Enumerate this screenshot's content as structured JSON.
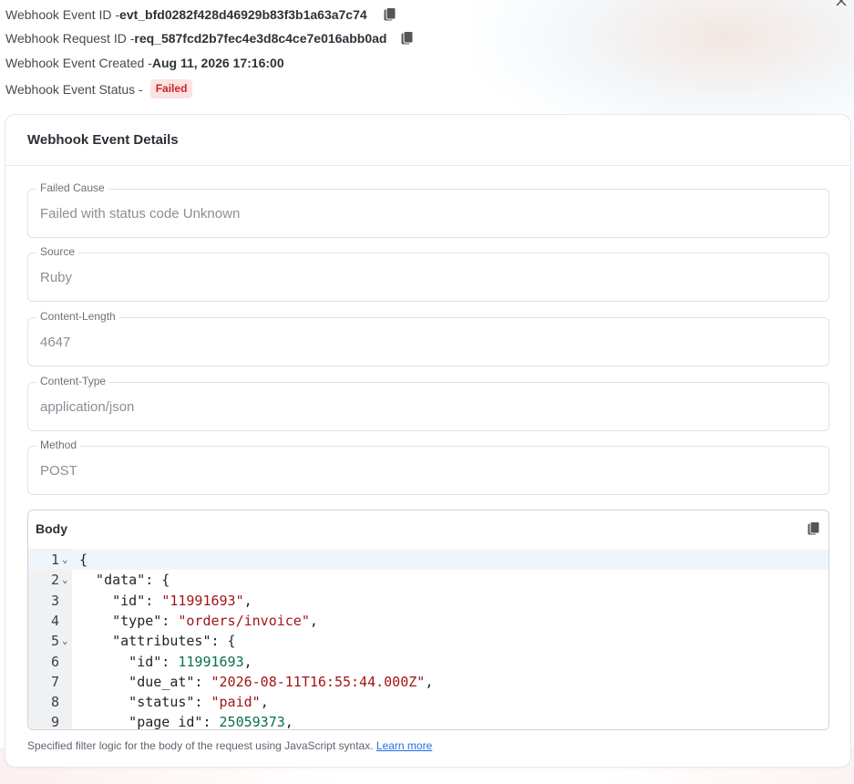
{
  "header": {
    "event_id": {
      "label": "Webhook Event ID -",
      "value": "evt_bfd0282f428d46929b83f3b1a63a7c74"
    },
    "request_id": {
      "label": "Webhook Request ID -",
      "value": "req_587fcd2b7fec4e3d8c4ce7e016abb0ad"
    },
    "created": {
      "label": "Webhook Event Created -",
      "value": "Aug 11, 2026 17:16:00"
    },
    "status": {
      "label": "Webhook Event Status -",
      "value": "Failed"
    },
    "close_icon": "close-icon"
  },
  "card": {
    "title": "Webhook Event Details",
    "fields": [
      {
        "label": "Failed Cause",
        "value": "Failed with status code Unknown"
      },
      {
        "label": "Source",
        "value": "Ruby"
      },
      {
        "label": "Content-Length",
        "value": "4647"
      },
      {
        "label": "Content-Type",
        "value": "application/json"
      },
      {
        "label": "Method",
        "value": "POST"
      }
    ],
    "body": {
      "label": "Body",
      "copy_icon": "copy-icon",
      "lines": [
        {
          "n": "1",
          "fold": true,
          "tokens": [
            [
              "k",
              "{"
            ]
          ]
        },
        {
          "n": "2",
          "fold": true,
          "tokens": [
            [
              "k",
              "  \"data\": {"
            ]
          ]
        },
        {
          "n": "3",
          "fold": false,
          "tokens": [
            [
              "k",
              "    \"id\": "
            ],
            [
              "s",
              "\"11991693\""
            ],
            [
              "k",
              ","
            ]
          ]
        },
        {
          "n": "4",
          "fold": false,
          "tokens": [
            [
              "k",
              "    \"type\": "
            ],
            [
              "s",
              "\"orders/invoice\""
            ],
            [
              "k",
              ","
            ]
          ]
        },
        {
          "n": "5",
          "fold": true,
          "tokens": [
            [
              "k",
              "    \"attributes\": {"
            ]
          ]
        },
        {
          "n": "6",
          "fold": false,
          "tokens": [
            [
              "k",
              "      \"id\": "
            ],
            [
              "n",
              "11991693"
            ],
            [
              "k",
              ","
            ]
          ]
        },
        {
          "n": "7",
          "fold": false,
          "tokens": [
            [
              "k",
              "      \"due_at\": "
            ],
            [
              "s",
              "\"2026-08-11T16:55:44.000Z\""
            ],
            [
              "k",
              ","
            ]
          ]
        },
        {
          "n": "8",
          "fold": false,
          "tokens": [
            [
              "k",
              "      \"status\": "
            ],
            [
              "s",
              "\"paid\""
            ],
            [
              "k",
              ","
            ]
          ]
        },
        {
          "n": "9",
          "fold": false,
          "tokens": [
            [
              "k",
              "      \"page_id\": "
            ],
            [
              "n",
              "25059373"
            ],
            [
              "k",
              ","
            ]
          ]
        }
      ]
    },
    "helper_text": "Specified filter logic for the body of the request using JavaScript syntax.",
    "helper_link": "Learn more"
  },
  "colors": {
    "failed_badge_bg": "#fde2e2",
    "failed_badge_text": "#c62828",
    "string": "#a31515",
    "number": "#0b6e4f",
    "link": "#1f6feb"
  }
}
